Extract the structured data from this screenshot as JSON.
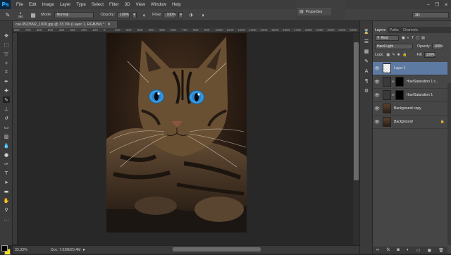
{
  "app": {
    "logo": "Ps"
  },
  "menubar": {
    "items": [
      "File",
      "Edit",
      "Image",
      "Layer",
      "Type",
      "Select",
      "Filter",
      "3D",
      "View",
      "Window",
      "Help"
    ]
  },
  "options": {
    "brush_size": "390",
    "mode_label": "Mode:",
    "mode_value": "Normal",
    "opacity_label": "Opacity:",
    "opacity_value": "100%",
    "flow_label": "Flow:",
    "flow_value": "100%",
    "workspace": "3D"
  },
  "properties_panel": {
    "title": "Properties"
  },
  "document": {
    "tab_title": "cat-3523992_1920.jpg @ 33.3% (Layer 1, RGB/8#) *"
  },
  "ruler": {
    "labels": [
      "800",
      "700",
      "600",
      "500",
      "400",
      "300",
      "200",
      "100",
      "0",
      "100",
      "200",
      "300",
      "400",
      "500",
      "600",
      "700",
      "800",
      "900",
      "1000",
      "1100",
      "1200",
      "1300",
      "1400",
      "1500",
      "1600",
      "1700",
      "1800",
      "1900",
      "2000",
      "2100",
      "2200"
    ]
  },
  "status": {
    "zoom": "33.33%",
    "doc_info": "Doc: 7.03M/20.4M"
  },
  "layers_panel": {
    "tabs": [
      "Layers",
      "Paths",
      "Channels"
    ],
    "filter_kind": "Kind",
    "blend_mode": "Hard Light",
    "opacity_label": "Opacity:",
    "opacity_value": "100%",
    "lock_label": "Lock:",
    "fill_label": "Fill:",
    "fill_value": "100%",
    "layers": [
      {
        "name": "Layer 1",
        "selected": true
      },
      {
        "name": "Hue/Saturation 1 c...",
        "selected": false
      },
      {
        "name": "Hue/Saturation 1",
        "selected": false
      },
      {
        "name": "Background copy",
        "selected": false
      },
      {
        "name": "Background",
        "selected": false
      }
    ]
  },
  "colors": {
    "accent": "#5d7aa3",
    "ps_blue": "#31a8ff",
    "foreground": "#000000",
    "background": "#f4e21b"
  }
}
